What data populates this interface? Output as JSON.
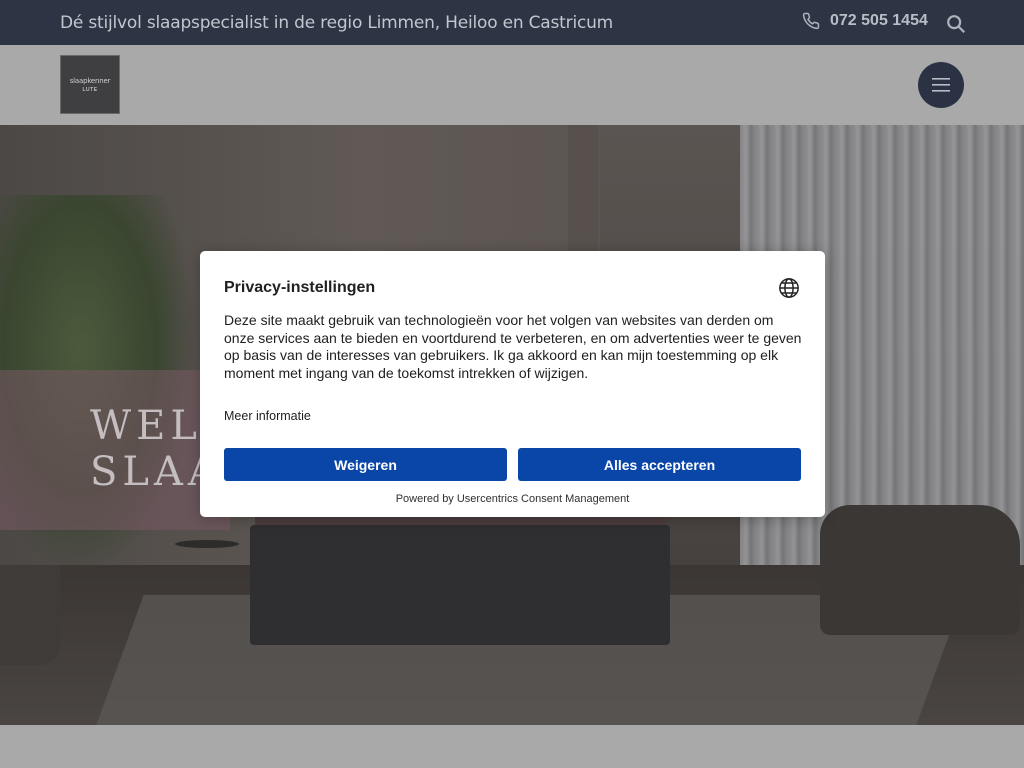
{
  "topbar": {
    "tagline": "Dé stijlvol slaapspecialist in de regio Limmen, Heiloo en Castricum",
    "phone": "072 505 1454",
    "icons": {
      "phone": "phone-icon",
      "search": "search-icon"
    }
  },
  "header": {
    "logo": {
      "line1": "slaapkenner",
      "line2": "LUTE"
    },
    "menu_icon": "hamburger-menu-icon"
  },
  "hero": {
    "heading_line1": "WEL",
    "heading_line2": "SLAA"
  },
  "consent": {
    "title": "Privacy-instellingen",
    "globe_icon": "globe-icon",
    "body": "Deze site maakt gebruik van technologieën voor het volgen van websites van derden om onze services aan te bieden en voortdurend te verbeteren, en om advertenties weer te geven op basis van de interesses van gebruikers. Ik ga akkoord en kan mijn toestemming op elk moment met ingang van de toekomst intrekken of wijzigen.",
    "more_info": "Meer informatie",
    "deny_label": "Weigeren",
    "accept_label": "Alles accepteren",
    "powered_by": "Powered by Usercentrics Consent Management"
  },
  "colors": {
    "topbar_bg": "#2d3545",
    "button_bg": "#0a45a8",
    "modal_bg": "#ffffff",
    "overlay_gray": "#a9a9a9"
  }
}
